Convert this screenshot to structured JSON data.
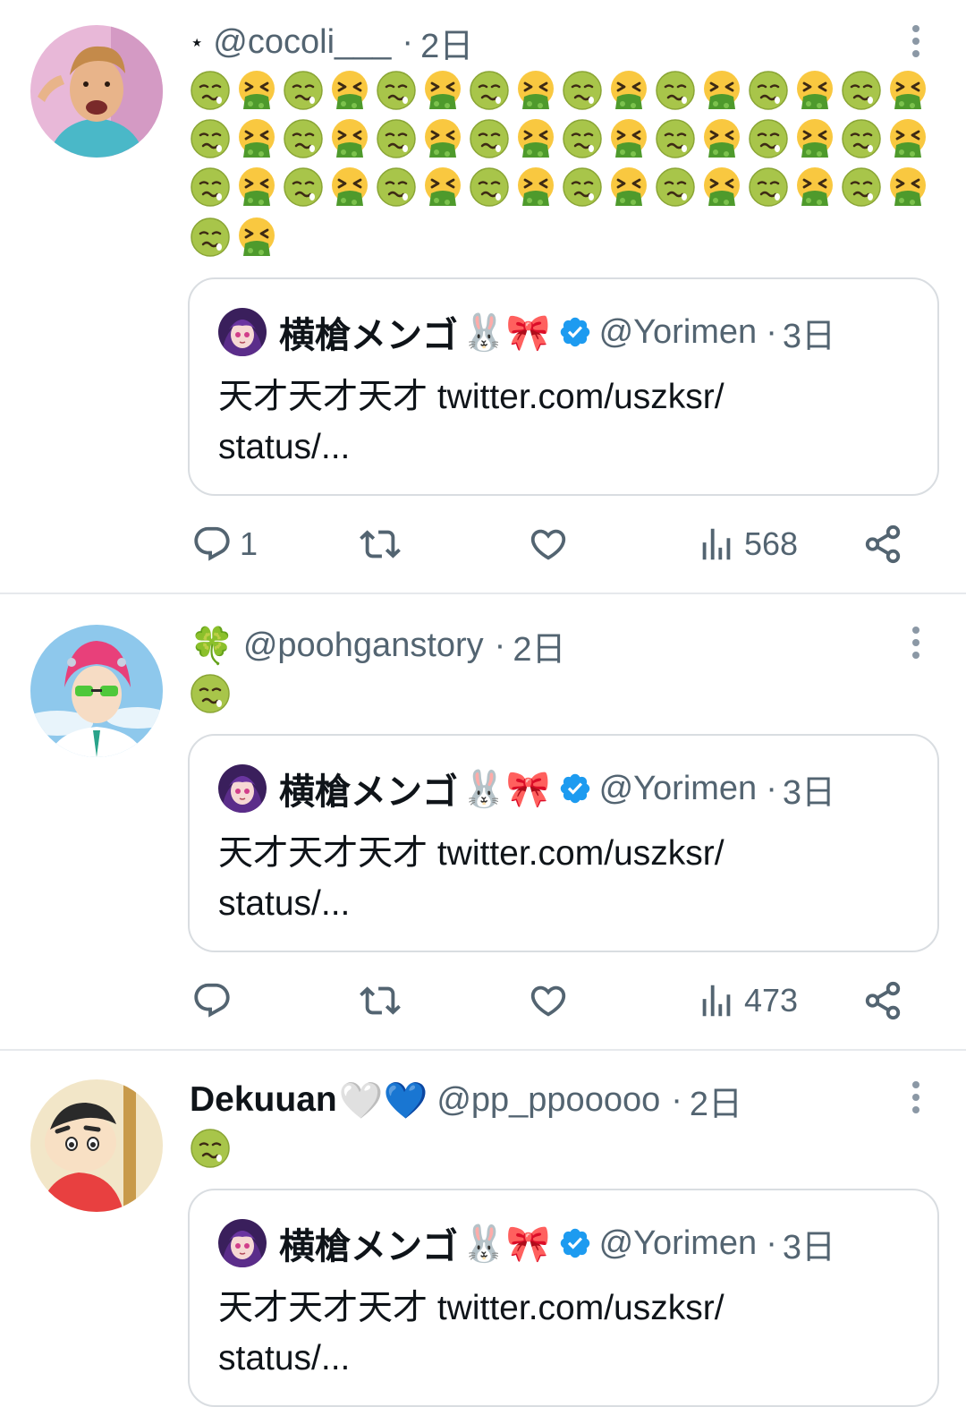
{
  "colors": {
    "accent": "#1d9bf0",
    "secondary_text": "#536471",
    "border": "#d9dde1"
  },
  "tweets": [
    {
      "prefix": "⋆",
      "name": "",
      "name_emoji": "",
      "handle": "@cocoli___",
      "dot": "·",
      "time": "2日",
      "avatar": "avatar-cartoon-man",
      "body_emojis_pattern": [
        "nauseated-face",
        "vomiting-face"
      ],
      "body_emoji_count": 50,
      "quote": {
        "name": "横槍メンゴ",
        "emojis": "🐰🎀",
        "handle": "@Yorimen",
        "dot": "·",
        "time": "3日",
        "text_line1": "天才天才天才 twitter.com/uszksr/",
        "text_line2": "status/..."
      },
      "replies": "1",
      "retweets": "",
      "likes": "",
      "views": "568"
    },
    {
      "prefix": "🍀",
      "name": "",
      "handle": "@poohganstory",
      "dot": "·",
      "time": "2日",
      "avatar": "avatar-pink-hair-boy",
      "body_emoji_count": 1,
      "quote": {
        "name": "横槍メンゴ",
        "emojis": "🐰🎀",
        "handle": "@Yorimen",
        "dot": "·",
        "time": "3日",
        "text_line1": "天才天才天才 twitter.com/uszksr/",
        "text_line2": "status/..."
      },
      "replies": "",
      "retweets": "",
      "likes": "",
      "views": "473"
    },
    {
      "prefix": "",
      "name": "Dekuuan",
      "name_emoji": "🤍💙",
      "handle": "@pp_ppooooo",
      "dot": "·",
      "time": "2日",
      "avatar": "avatar-shinchan",
      "body_emoji_count": 1,
      "quote": {
        "name": "横槍メンゴ",
        "emojis": "🐰🎀",
        "handle": "@Yorimen",
        "dot": "·",
        "time": "3日",
        "text_line1": "天才天才天才 twitter.com/uszksr/",
        "text_line2": "status/..."
      }
    }
  ]
}
